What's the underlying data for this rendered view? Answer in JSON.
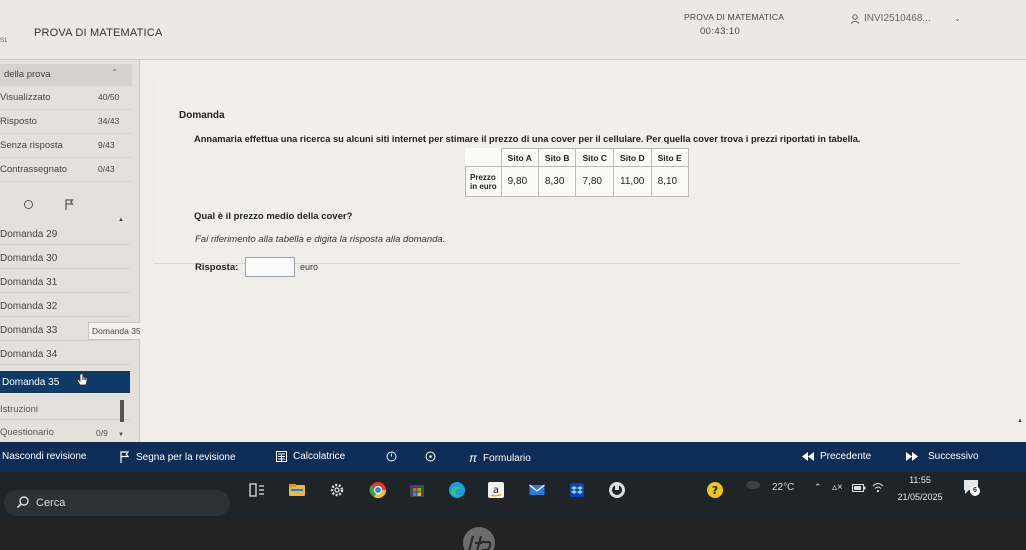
{
  "header": {
    "edge_text": "S1",
    "title": "PROVA DI MATEMATICA",
    "center_title": "PROVA DI MATEMATICA",
    "timer": "00:43:10",
    "user": "INVI2510468..."
  },
  "sidebar": {
    "section_title": "della prova",
    "stats": [
      {
        "label": "Visualizzato",
        "value": "40/50"
      },
      {
        "label": "Risposto",
        "value": "34/43"
      },
      {
        "label": "Senza risposta",
        "value": "9/43"
      },
      {
        "label": "Contrassegnato",
        "value": "0/43"
      }
    ],
    "questions": [
      "Domanda 29",
      "Domanda 30",
      "Domanda 31",
      "Domanda 32",
      "Domanda 33",
      "Domanda 34",
      "Domanda 35"
    ],
    "tooltip": "Domanda 35",
    "footer_items": [
      "Istruzioni",
      "Questionario"
    ],
    "footer_count": "0/9"
  },
  "question": {
    "label": "Domanda",
    "text": "Annamaria effettua una ricerca su alcuni siti internet per stimare il prezzo di una cover per il cellulare. Per quella cover trova i prezzi riportati in tabella.",
    "table": {
      "headers": [
        "Sito A",
        "Sito B",
        "Sito C",
        "Sito D",
        "Sito E"
      ],
      "row_label_line1": "Prezzo",
      "row_label_line2": "in euro",
      "values": [
        "9,80",
        "8,30",
        "7,80",
        "11,00",
        "8,10"
      ]
    },
    "prompt": "Qual è il prezzo medio della cover?",
    "hint": "Fai riferimento alla tabella e digita la risposta alla domanda.",
    "answer_label": "Risposta:",
    "answer_value": "",
    "answer_unit": "euro"
  },
  "navbar": {
    "hide_review": "Nascondi revisione",
    "flag_review": "Segna per la revisione",
    "calculator": "Calcolatrice",
    "formulary": "Formulario",
    "previous": "Precedente",
    "next": "Successivo"
  },
  "taskbar": {
    "search_placeholder": "Cerca",
    "temperature": "22°C",
    "time": "11:55",
    "date": "21/05/2025",
    "notification_count": "6",
    "colors": {
      "taskbar_bg": "#1f2429",
      "navbar_bg": "#0d2d57",
      "accent": "#0f3a66"
    }
  }
}
